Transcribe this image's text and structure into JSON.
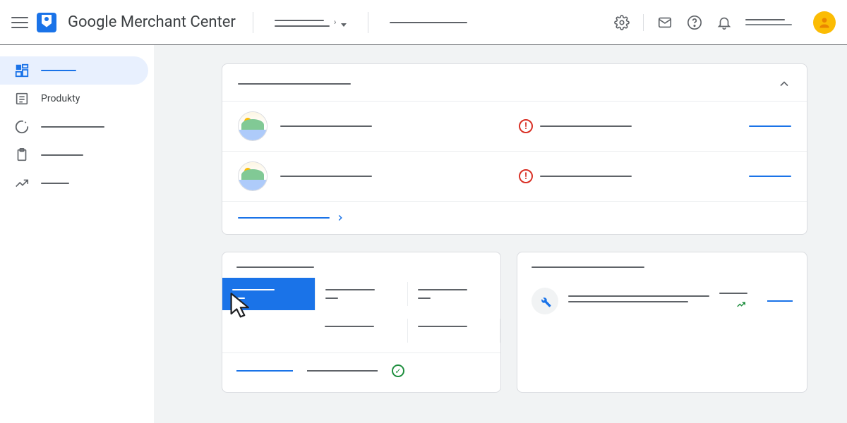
{
  "header": {
    "app_title": "Google Merchant Center",
    "selector_label": "",
    "secondary_text": "",
    "user_link": ""
  },
  "sidebar": {
    "items": [
      {
        "id": "overview",
        "label": "",
        "active": true
      },
      {
        "id": "products",
        "label": "Produkty",
        "active": false
      },
      {
        "id": "performance",
        "label": "",
        "active": false
      },
      {
        "id": "orders",
        "label": "",
        "active": false
      },
      {
        "id": "growth",
        "label": "",
        "active": false
      }
    ]
  },
  "main": {
    "products_card": {
      "title": "",
      "rows": [
        {
          "name": "",
          "status_text": "",
          "status": "error",
          "action": ""
        },
        {
          "name": "",
          "status_text": "",
          "status": "error",
          "action": ""
        }
      ],
      "footer_link": ""
    },
    "stats_card": {
      "title": "",
      "metrics_row1": [
        {
          "label": "",
          "value": "",
          "selected": true
        },
        {
          "label": "",
          "value": "",
          "selected": false
        },
        {
          "label": "",
          "value": "",
          "selected": false
        }
      ],
      "metrics_row2": [
        {
          "label": "",
          "value": "",
          "selected": false
        },
        {
          "label": "",
          "value": "",
          "selected": false
        },
        {
          "label": "",
          "value": "",
          "selected": false
        }
      ],
      "footer_link": "",
      "footer_text": "",
      "footer_status": "success"
    },
    "recommendations_card": {
      "title": "",
      "item": {
        "text_line1": "",
        "text_line2": "",
        "stat": "",
        "trend": "up",
        "action": ""
      }
    }
  },
  "icons": {
    "menu": "menu",
    "logo": "tag",
    "gear": "settings",
    "mail": "mail",
    "help": "help",
    "bell": "notifications",
    "avatar": "person",
    "dashboard": "dashboard",
    "list": "list",
    "donut": "donut",
    "clipboard": "clipboard",
    "trending": "trending_up",
    "chevron_up": "expand_less",
    "chevron_right": "chevron_right",
    "error": "error",
    "check": "check_circle",
    "wrench": "build"
  },
  "colors": {
    "primary": "#1a73e8",
    "error": "#d93025",
    "success": "#1e8e3e",
    "avatar": "#fbbc04",
    "text": "#3c4043",
    "muted": "#5f6368",
    "border": "#dadce0",
    "bg": "#f1f3f4"
  }
}
